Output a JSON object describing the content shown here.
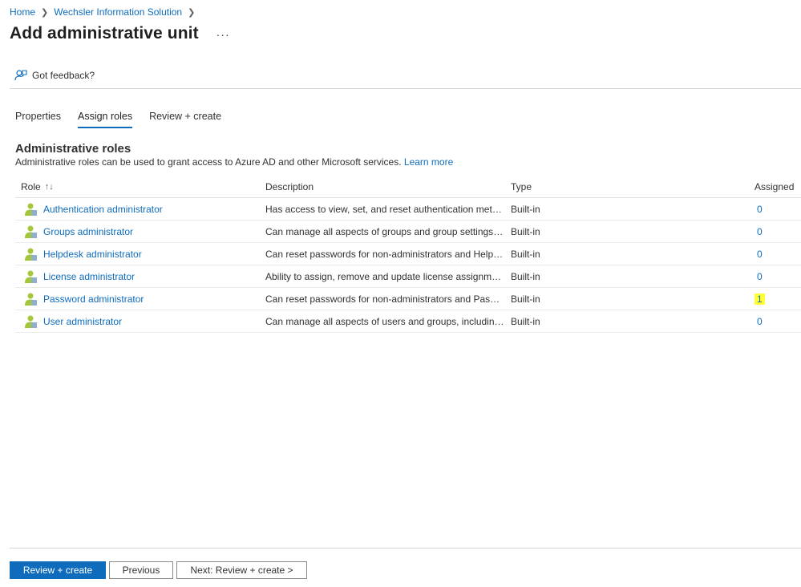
{
  "breadcrumb": {
    "items": [
      "Home",
      "Wechsler Information Solution"
    ]
  },
  "page": {
    "title": "Add administrative unit",
    "more": "···"
  },
  "command_bar": {
    "feedback_label": "Got feedback?"
  },
  "tabs": [
    {
      "label": "Properties",
      "active": false
    },
    {
      "label": "Assign roles",
      "active": true
    },
    {
      "label": "Review + create",
      "active": false
    }
  ],
  "section": {
    "title": "Administrative roles",
    "description": "Administrative roles can be used to grant access to Azure AD and other Microsoft services.",
    "learn_more": "Learn more"
  },
  "table": {
    "columns": [
      "Role",
      "Description",
      "Type",
      "Assigned"
    ],
    "sort_indicator": "↑↓",
    "rows": [
      {
        "role": "Authentication administrator",
        "description": "Has access to view, set, and reset authentication method ...",
        "type": "Built-in",
        "assigned": "0",
        "highlight": false
      },
      {
        "role": "Groups administrator",
        "description": "Can manage all aspects of groups and group settings lik...",
        "type": "Built-in",
        "assigned": "0",
        "highlight": false
      },
      {
        "role": "Helpdesk administrator",
        "description": "Can reset passwords for non-administrators and Helpde...",
        "type": "Built-in",
        "assigned": "0",
        "highlight": false
      },
      {
        "role": "License administrator",
        "description": "Ability to assign, remove and update license assignments.",
        "type": "Built-in",
        "assigned": "0",
        "highlight": false
      },
      {
        "role": "Password administrator",
        "description": "Can reset passwords for non-administrators and Passwo...",
        "type": "Built-in",
        "assigned": "1",
        "highlight": true
      },
      {
        "role": "User administrator",
        "description": "Can manage all aspects of users and groups, including r...",
        "type": "Built-in",
        "assigned": "0",
        "highlight": false
      }
    ]
  },
  "footer": {
    "primary_label": "Review + create",
    "previous_label": "Previous",
    "next_label": "Next: Review + create >"
  },
  "colors": {
    "accent": "#0f6cbd",
    "highlight": "#ffff33",
    "text": "#323130"
  },
  "icons": {
    "role": "user-role-icon",
    "feedback": "feedback-icon",
    "chevron": "chevron-right-icon",
    "sort": "sort-icon"
  }
}
